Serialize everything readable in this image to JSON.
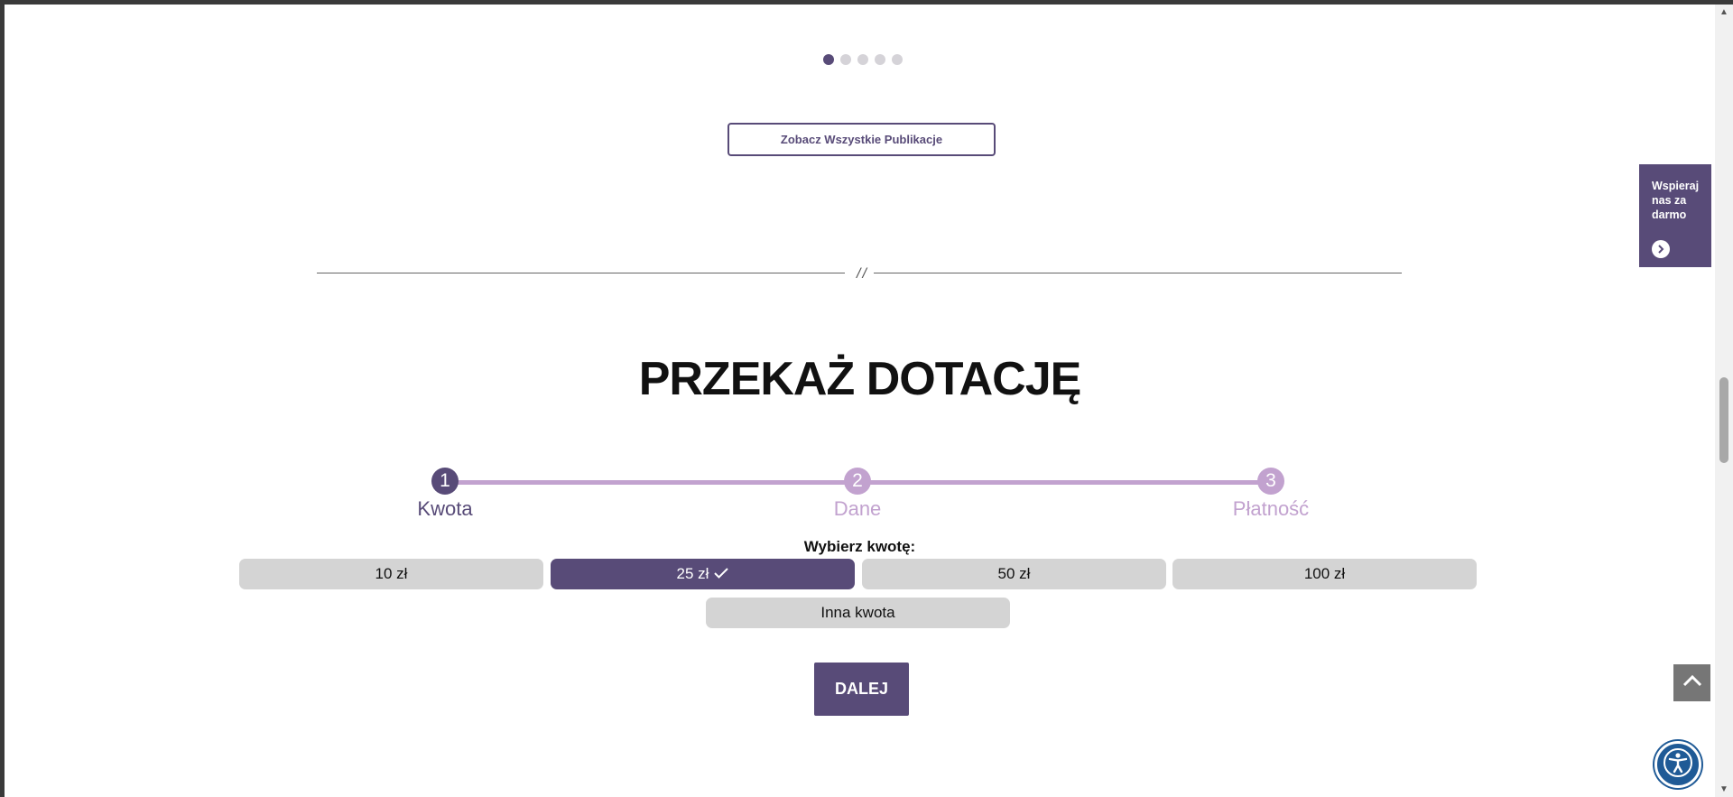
{
  "carousel": {
    "dot_count": 5,
    "active_index": 0
  },
  "publications_button": "Zobacz Wszystkie Publikacje",
  "divider_mark": "//",
  "donation": {
    "title": "PRZEKAŻ DOTACJĘ",
    "steps": [
      {
        "number": "1",
        "label": "Kwota",
        "active": true
      },
      {
        "number": "2",
        "label": "Dane",
        "active": false
      },
      {
        "number": "3",
        "label": "Płatność",
        "active": false
      }
    ],
    "amount_prompt": "Wybierz kwotę:",
    "amounts": [
      "10 zł",
      "25 zł",
      "50 zł",
      "100 zł"
    ],
    "selected_amount_index": 1,
    "other_amount": "Inna kwota",
    "next_button": "DALEJ"
  },
  "support_widget": {
    "text": "Wspieraj nas za darmo"
  },
  "colors": {
    "brand": "#584b78",
    "step_inactive": "#c2a2cf",
    "amount_bg": "#d4d4d4"
  },
  "icons": {
    "check": "check-icon",
    "arrow": "chevron-right-icon",
    "top": "chevron-up-icon",
    "accessibility": "accessibility-icon"
  }
}
